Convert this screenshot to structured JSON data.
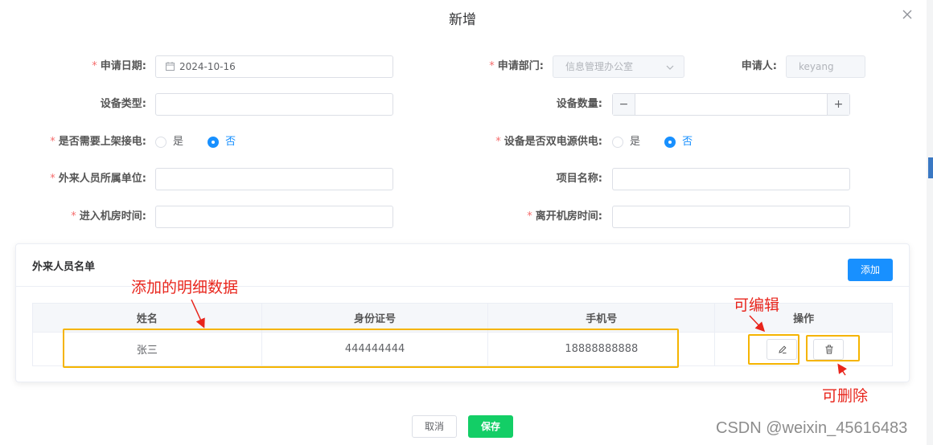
{
  "dialog": {
    "title": "新增"
  },
  "form": {
    "apply_date": {
      "label": "申请日期:",
      "value": "2024-10-16"
    },
    "department": {
      "label": "申请部门:",
      "value": "信息管理办公室"
    },
    "applicant": {
      "label": "申请人:",
      "value": "keyang"
    },
    "device_type": {
      "label": "设备类型:",
      "value": ""
    },
    "device_count": {
      "label": "设备数量:",
      "value": "",
      "dec": "−",
      "inc": "+"
    },
    "need_rack_power": {
      "label": "是否需要上架接电:",
      "options": [
        "是",
        "否"
      ],
      "selected": "否"
    },
    "dual_power": {
      "label": "设备是否双电源供电:",
      "options": [
        "是",
        "否"
      ],
      "selected": "否"
    },
    "visitor_org": {
      "label": "外来人员所属单位:",
      "value": ""
    },
    "project_name": {
      "label": "项目名称:",
      "value": ""
    },
    "enter_time": {
      "label": "进入机房时间:",
      "value": ""
    },
    "leave_time": {
      "label": "离开机房时间:",
      "value": ""
    },
    "required_mark": "*"
  },
  "visitor_list": {
    "title": "外来人员名单",
    "add_label": "添加",
    "columns": [
      "姓名",
      "身份证号",
      "手机号",
      "操作"
    ],
    "rows": [
      {
        "name": "张三",
        "id_number": "444444444",
        "phone": "18888888888"
      }
    ]
  },
  "annotations": {
    "detail": "添加的明细数据",
    "editable": "可编辑",
    "deletable": "可删除",
    "color": "#e8251c",
    "box_color": "#f5b400"
  },
  "footer": {
    "cancel_label": "取消",
    "save_label": "保存"
  },
  "watermark": "CSDN @weixin_45616483",
  "colors": {
    "primary": "#1890ff",
    "save": "#13ce66",
    "required": "#f56c6c"
  }
}
